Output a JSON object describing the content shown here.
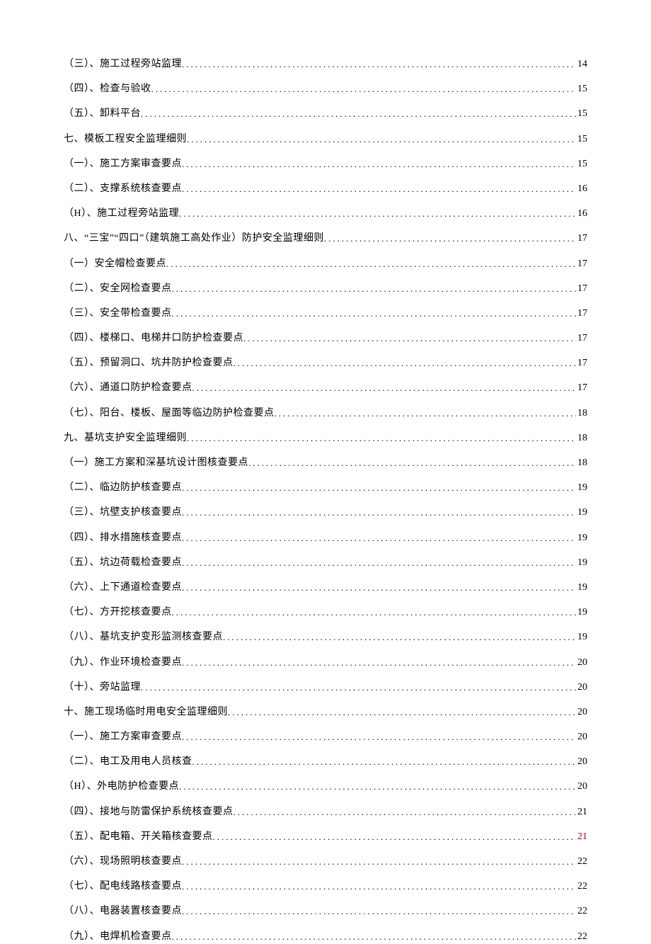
{
  "toc": [
    {
      "label": "（三）、施工过程旁站监理",
      "page": "14",
      "level": 2
    },
    {
      "label": "（四）、检查与验收",
      "page": "15",
      "level": 2
    },
    {
      "label": "（五）、卸料平台",
      "page": "15",
      "level": 2
    },
    {
      "label": "七、模板工程安全监理细则",
      "page": "15",
      "level": 1
    },
    {
      "label": "（一）、施工方案审查要点",
      "page": "15",
      "level": 2
    },
    {
      "label": "（二）、支撑系统核查要点",
      "page": "16",
      "level": 2
    },
    {
      "label": "（H）、施工过程旁站监理",
      "page": "16",
      "level": 2
    },
    {
      "label": "八、“三宝”“四口”（建筑施工高处作业）防护安全监理细则",
      "page": "17",
      "level": 1
    },
    {
      "label": "（一）安全帽检查要点",
      "page": "17",
      "level": 2
    },
    {
      "label": "（二）、安全网检查要点",
      "page": "17",
      "level": 2
    },
    {
      "label": "（三）、安全带检查要点",
      "page": "17",
      "level": 2
    },
    {
      "label": "（四）、楼梯口、电梯井口防护检查要点",
      "page": "17",
      "level": 2
    },
    {
      "label": "（五）、预留洞口、坑井防护检查要点",
      "page": "17",
      "level": 2
    },
    {
      "label": "（六）、通道口防护检查要点",
      "page": "17",
      "level": 2
    },
    {
      "label": "（七）、阳台、楼板、屋面等临边防护检查要点",
      "page": "18",
      "level": 2
    },
    {
      "label": "九、基坑支护安全监理细则",
      "page": "18",
      "level": 1
    },
    {
      "label": "（一）施工方案和深基坑设计图核查要点",
      "page": "18",
      "level": 2
    },
    {
      "label": "（二）、临边防护核查要点",
      "page": "19",
      "level": 2
    },
    {
      "label": "（三）、坑壁支护核查要点",
      "page": "19",
      "level": 2
    },
    {
      "label": "（四）、排水措施核查要点",
      "page": "19",
      "level": 2
    },
    {
      "label": "（五）、坑边荷载检查要点",
      "page": "19",
      "level": 2
    },
    {
      "label": "（六）、上下通道检查要点",
      "page": "19",
      "level": 2
    },
    {
      "label": "（七）、方开挖核查要点",
      "page": "19",
      "level": 2
    },
    {
      "label": "（八）、基坑支护变形监测核查要点",
      "page": "19",
      "level": 2
    },
    {
      "label": "（九）、作业环境检查要点",
      "page": "20",
      "level": 2
    },
    {
      "label": "（十）、旁站监理",
      "page": "20",
      "level": 2
    },
    {
      "label": "十、施工现场临时用电安全监理细则",
      "page": "20",
      "level": 1
    },
    {
      "label": "（一）、施工方案审查要点",
      "page": "20",
      "level": 2
    },
    {
      "label": "（二）、电工及用电人员核查",
      "page": "20",
      "level": 2
    },
    {
      "label": "（H）、外电防护检查要点",
      "page": "20",
      "level": 2
    },
    {
      "label": "（四）、接地与防雷保护系统核查要点",
      "page": "21",
      "level": 2
    },
    {
      "label": "（五）、配电箱、开关箱核查要点",
      "page": "21",
      "level": 2,
      "red": true
    },
    {
      "label": "（六）、现场照明核查要点",
      "page": "22",
      "level": 2
    },
    {
      "label": "（七）、配电线路核查要点",
      "page": "22",
      "level": 2
    },
    {
      "label": "（八）、电器装置核查要点",
      "page": "22",
      "level": 2
    },
    {
      "label": "（九）、电焊机检查要点",
      "page": "22",
      "level": 2
    }
  ]
}
